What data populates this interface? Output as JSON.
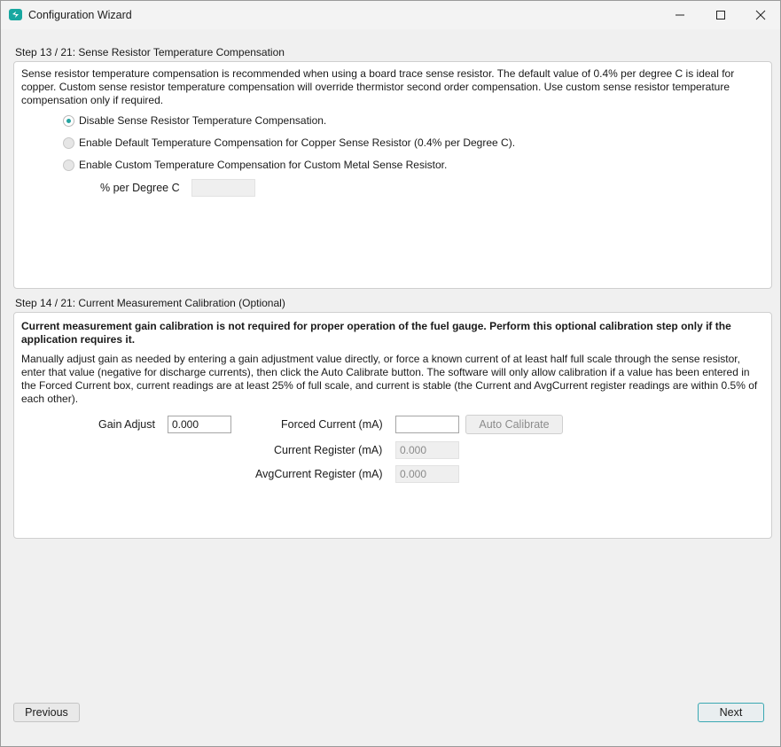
{
  "window": {
    "title": "Configuration Wizard",
    "accent": "#18a7a0"
  },
  "step13": {
    "header": "Step 13 / 21: Sense Resistor Temperature Compensation",
    "description": "Sense resistor temperature compensation is recommended when using a board trace sense resistor. The default value of 0.4% per degree C is ideal for copper. Custom sense resistor temperature compensation will override thermistor second order compensation. Use custom sense resistor temperature compensation only if required.",
    "options": [
      {
        "label": "Disable Sense Resistor Temperature Compensation.",
        "selected": true
      },
      {
        "label": "Enable Default Temperature Compensation for Copper Sense Resistor (0.4% per Degree C).",
        "selected": false
      },
      {
        "label": "Enable Custom Temperature Compensation for Custom Metal Sense Resistor.",
        "selected": false
      }
    ],
    "percent_label": "% per Degree C",
    "percent_value": ""
  },
  "step14": {
    "header": "Step 14 / 21: Current Measurement Calibration (Optional)",
    "bold_note": "Current measurement gain calibration is not required for proper operation of the fuel gauge. Perform this optional calibration step only if the application requires it.",
    "description": "Manually adjust gain as needed by entering a gain adjustment value directly, or force a known current of at least half full scale through the sense resistor, enter that value (negative for discharge currents), then click the Auto Calibrate button. The software will only allow calibration if a value has been entered in the Forced Current box, current readings are at least 25% of full scale, and current is stable (the Current and AvgCurrent register readings are within 0.5% of each other).",
    "gain_label": "Gain Adjust",
    "gain_value": "0.000",
    "forced_label": "Forced Current (mA)",
    "forced_value": "",
    "auto_calibrate_label": "Auto Calibrate",
    "current_register_label": "Current Register (mA)",
    "current_register_value": "0.000",
    "avg_register_label": "AvgCurrent Register (mA)",
    "avg_register_value": "0.000"
  },
  "footer": {
    "previous_label": "Previous",
    "next_label": "Next"
  }
}
